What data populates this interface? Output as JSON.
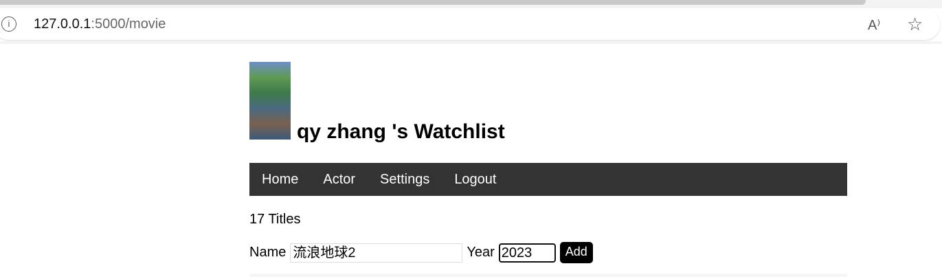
{
  "browser": {
    "url_host": "127.0.0.1",
    "url_path": ":5000/movie",
    "info_icon": "info-icon",
    "read_aloud_icon": "A⁾",
    "favorite_icon": "☆"
  },
  "header": {
    "title": "qy zhang 's Watchlist"
  },
  "nav": {
    "items": [
      {
        "label": "Home"
      },
      {
        "label": "Actor"
      },
      {
        "label": "Settings"
      },
      {
        "label": "Logout"
      }
    ]
  },
  "main": {
    "count": "17 Titles",
    "form": {
      "name_label": "Name",
      "name_value": "流浪地球2",
      "year_label": "Year",
      "year_value": "2023",
      "add_label": "Add"
    }
  }
}
